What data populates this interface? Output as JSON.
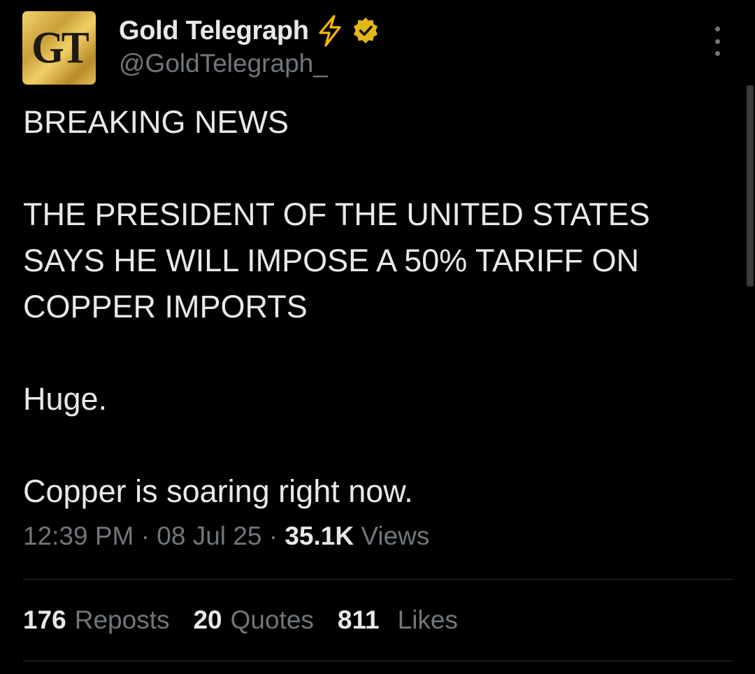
{
  "account": {
    "avatar_text": "GT",
    "display_name": "Gold Telegraph",
    "handle": "@GoldTelegraph_"
  },
  "icons": {
    "bolt": "lightning-bolt-icon",
    "verified": "verified-badge-icon",
    "more": "more-options-icon"
  },
  "colors": {
    "background": "#000000",
    "text": "#e7e9ea",
    "secondary": "#71767b",
    "bolt": "#f5b800",
    "verified_badge": "#e2b719",
    "divider": "#2f3336"
  },
  "tweet": {
    "line1": "BREAKING NEWS",
    "line2": "THE PRESIDENT OF THE UNITED STATES SAYS HE WILL IMPOSE A 50% TARIFF ON COPPER IMPORTS",
    "line3": "Huge.",
    "line4": "Copper is soaring right now."
  },
  "meta": {
    "time": "12:39 PM",
    "separator": " · ",
    "date": "08 Jul 25",
    "views_count": "35.1K",
    "views_label": "Views"
  },
  "stats": {
    "reposts_count": "176",
    "reposts_label": "Reposts",
    "quotes_count": "20",
    "quotes_label": "Quotes",
    "likes_count": "811",
    "likes_label": "Likes"
  }
}
